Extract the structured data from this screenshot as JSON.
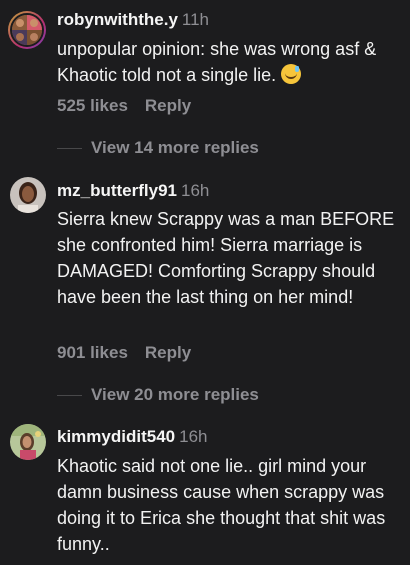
{
  "comments": [
    {
      "username": "robynwiththe.y",
      "time": "11h",
      "text": "unpopular opinion: she was wrong asf & Khaotic told not a single lie.",
      "emoji": "sweat-smile-emoji",
      "likes": "525 likes",
      "reply": "Reply",
      "view_more": "View 14 more replies"
    },
    {
      "username": "mz_butterfly91",
      "time": "16h",
      "text": "Sierra knew Scrappy was a man BEFORE she confronted him! Sierra marriage is DAMAGED! Comforting Scrappy should have been the last thing on her mind!",
      "likes": "901 likes",
      "reply": "Reply",
      "view_more": "View 20 more replies"
    },
    {
      "username": "kimmydidit540",
      "time": "16h",
      "text": "Khaotic said not one lie.. girl mind your damn business cause when scrappy was doing it to Erica she thought that shit was funny.."
    }
  ],
  "colors": {
    "background": "#1c1c1e",
    "secondary_text": "#8e8e93",
    "primary_text": "#f2f2f2"
  }
}
